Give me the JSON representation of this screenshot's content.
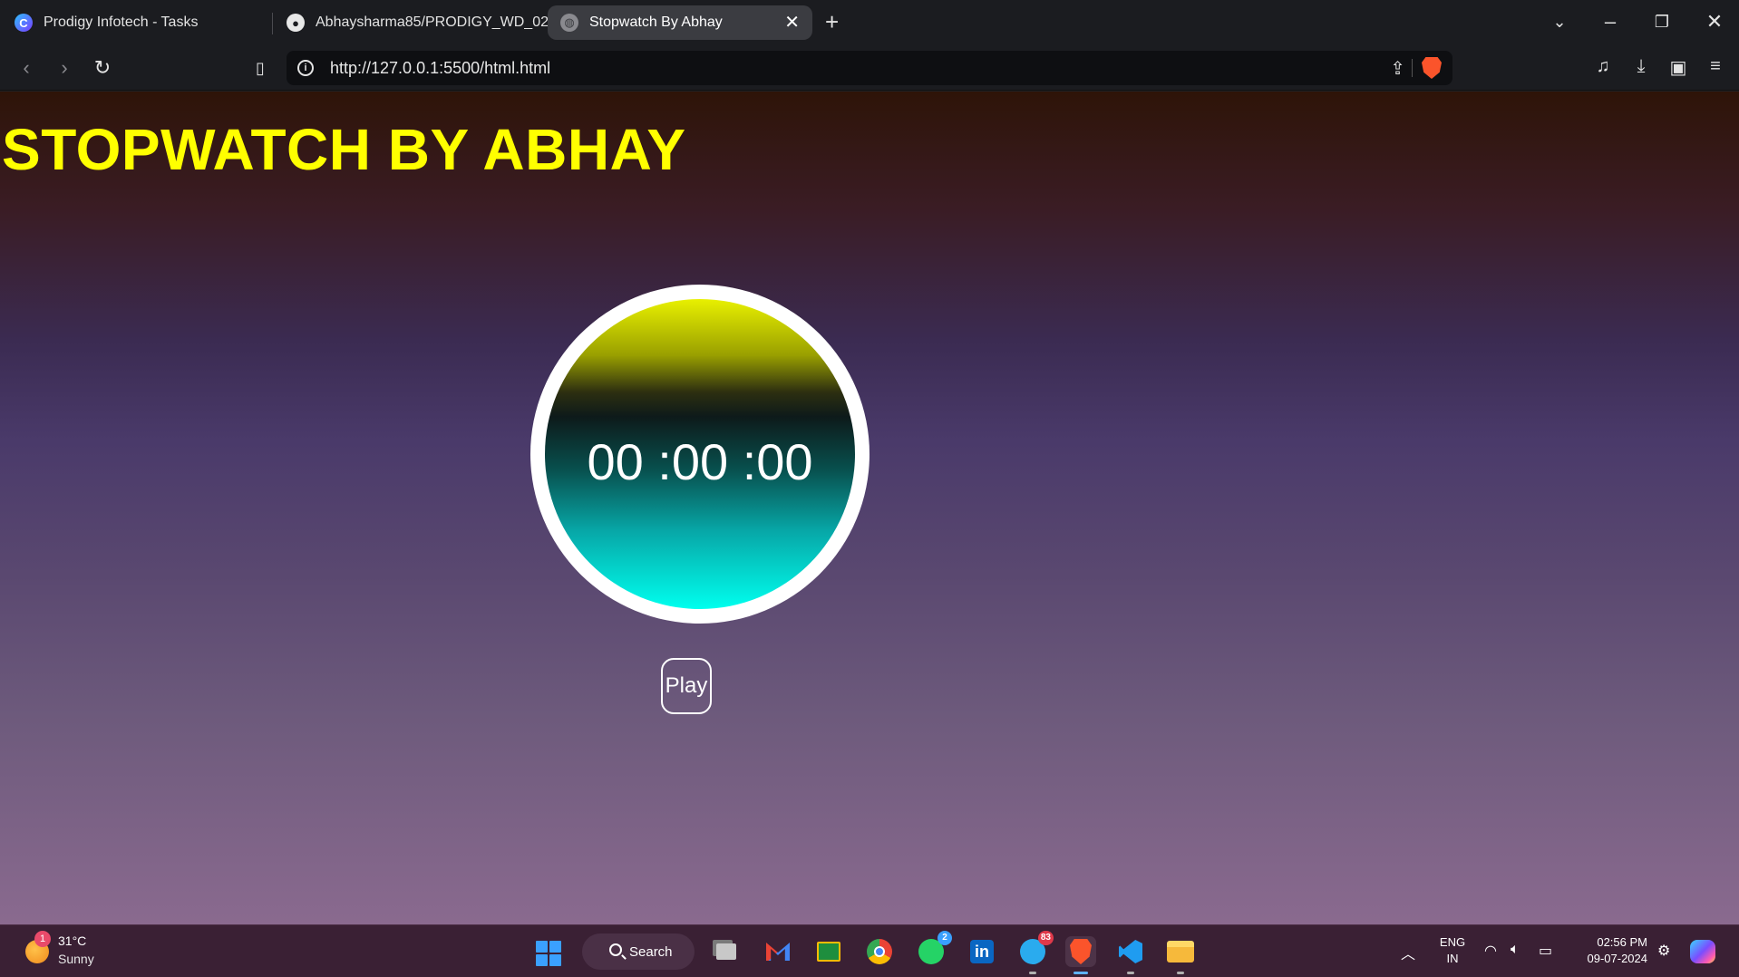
{
  "tabs": [
    {
      "title": "Prodigy Infotech - Tasks",
      "icon": "prodigy-icon"
    },
    {
      "title": "Abhaysharma85/PRODIGY_WD_02",
      "icon": "github-icon"
    },
    {
      "title": "Stopwatch By Abhay",
      "icon": "globe-icon",
      "active": true
    }
  ],
  "tab_close_glyph": "✕",
  "new_tab_glyph": "+",
  "address_bar": {
    "url": "http://127.0.0.1:5500/html.html"
  },
  "page": {
    "title": "STOPWATCH BY ABHAY",
    "timer_display": "00 :00 :00",
    "play_button": "Play",
    "title_color": "#ffff00"
  },
  "taskbar": {
    "weather": {
      "temp": "31°C",
      "condition": "Sunny",
      "badge": "1"
    },
    "search_label": "Search",
    "apps": [
      {
        "name": "task-view"
      },
      {
        "name": "gmail"
      },
      {
        "name": "google-classroom"
      },
      {
        "name": "chrome"
      },
      {
        "name": "whatsapp",
        "badge": "2"
      },
      {
        "name": "linkedin",
        "label": "in"
      },
      {
        "name": "telegram",
        "badge": "83"
      },
      {
        "name": "brave",
        "active": true
      },
      {
        "name": "vscode"
      },
      {
        "name": "file-explorer"
      }
    ],
    "language": {
      "line1": "ENG",
      "line2": "IN"
    },
    "time": "02:56 PM",
    "date": "09-07-2024"
  }
}
